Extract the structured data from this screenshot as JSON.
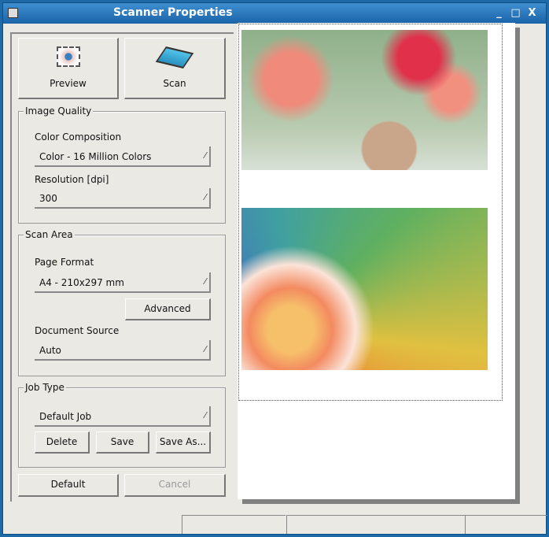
{
  "window": {
    "title": "Scanner Properties",
    "minimize": "_",
    "maximize": "□",
    "close": "X"
  },
  "toolbar": {
    "preview_label": "Preview",
    "scan_label": "Scan"
  },
  "image_quality": {
    "legend": "Image Quality",
    "color_label": "Color Composition",
    "color_value": "Color - 16 Million Colors",
    "resolution_label": "Resolution [dpi]",
    "resolution_value": "300"
  },
  "scan_area": {
    "legend": "Scan Area",
    "page_format_label": "Page Format",
    "page_format_value": "A4 - 210x297 mm",
    "advanced_label": "Advanced",
    "source_label": "Document Source",
    "source_value": "Auto"
  },
  "job_type": {
    "legend": "Job Type",
    "job_value": "Default Job",
    "delete_label": "Delete",
    "save_label": "Save",
    "save_as_label": "Save As..."
  },
  "footer": {
    "default_label": "Default",
    "cancel_label": "Cancel"
  }
}
